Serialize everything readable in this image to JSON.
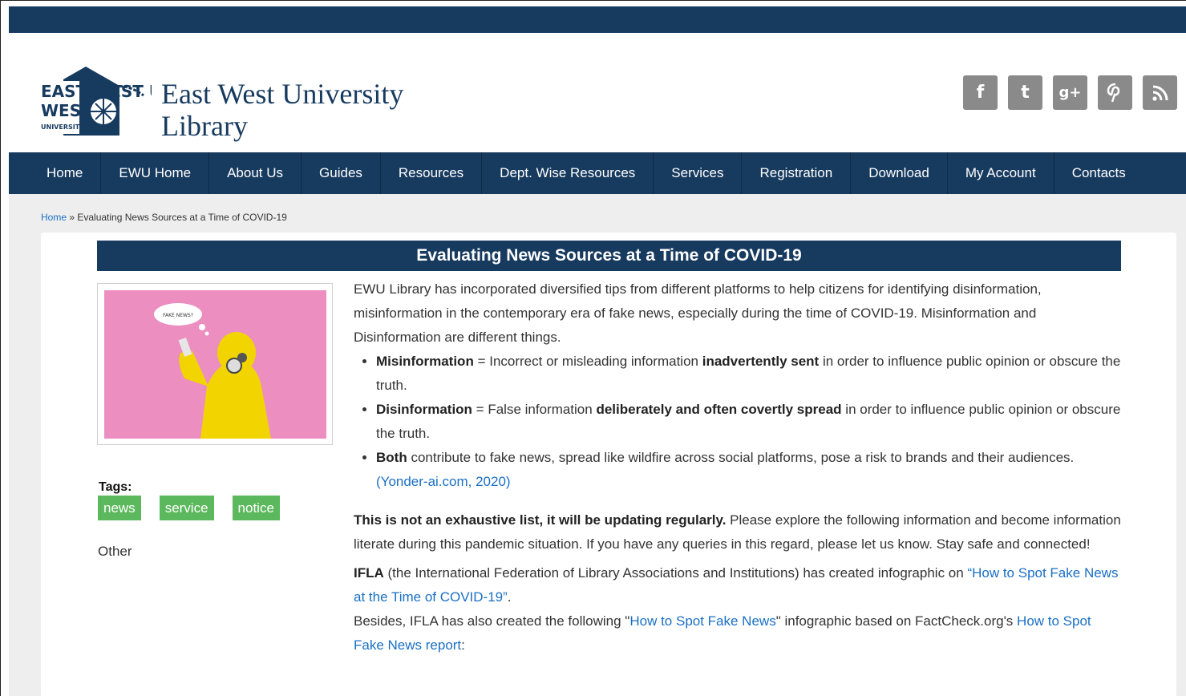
{
  "header": {
    "logo_mark": "EAST WEST UNIVERSITY",
    "logo_line1": "East West University",
    "logo_line2": "Library",
    "social": [
      {
        "icon": "facebook-icon",
        "glyph": "f"
      },
      {
        "icon": "twitter-icon",
        "glyph": "t"
      },
      {
        "icon": "google-plus-icon",
        "glyph": "g+"
      },
      {
        "icon": "pinterest-icon",
        "glyph": "p"
      },
      {
        "icon": "rss-icon",
        "glyph": "rss"
      }
    ]
  },
  "nav": [
    "Home",
    "EWU Home",
    "About Us",
    "Guides",
    "Resources",
    "Dept. Wise Resources",
    "Services",
    "Registration",
    "Download",
    "My Account",
    "Contacts"
  ],
  "breadcrumb": {
    "home": "Home",
    "sep": " » ",
    "current": "Evaluating News Sources at a Time of COVID-19"
  },
  "post": {
    "title": "Evaluating News Sources at a Time of COVID-19",
    "image_caption": "FAKE NEWS?",
    "tags_label": "Tags:",
    "tags": [
      "news",
      "service",
      "notice"
    ],
    "category": "Other",
    "intro": "EWU Library has incorporated diversified tips from different platforms to help citizens for identifying disinformation, misinformation in the contemporary era of fake news, especially during the time of COVID-19. Misinformation and Disinformation are different things.",
    "bullets": [
      {
        "term": "Misinformation",
        "a": " = Incorrect or misleading information ",
        "bold": "inadvertently sent",
        "b": " in order to influence public opinion or obscure the truth."
      },
      {
        "term": "Disinformation",
        "a": " = False information ",
        "bold": "deliberately and often covertly spread",
        "b": " in order to influence public opinion or obscure the truth."
      },
      {
        "term": "Both",
        "a": " contribute to fake news, spread like wildfire across social platforms, pose a risk to brands and their audiences.  ",
        "link": "(Yonder-ai.com, 2020)"
      }
    ],
    "notice_bold": "This is not an exhaustive list, it will be updating regularly.",
    "notice_rest": " Please explore the following information and become information literate during this pandemic situation. If you have any queries in this regard, please let us know. Stay safe and connected!",
    "ifla_bold": "IFLA",
    "ifla_text": " (the International Federation of Library Associations and Institutions) has created infographic on ",
    "ifla_link": "“How to Spot Fake News at the Time of COVID-19”",
    "ifla_end": ".",
    "besides_text": "Besides, IFLA has also created the following \"",
    "besides_link": "How to Spot Fake News",
    "besides_mid": "\" infographic based on FactCheck.org's ",
    "besides_link2": "How to Spot Fake News report",
    "besides_end": ":"
  }
}
